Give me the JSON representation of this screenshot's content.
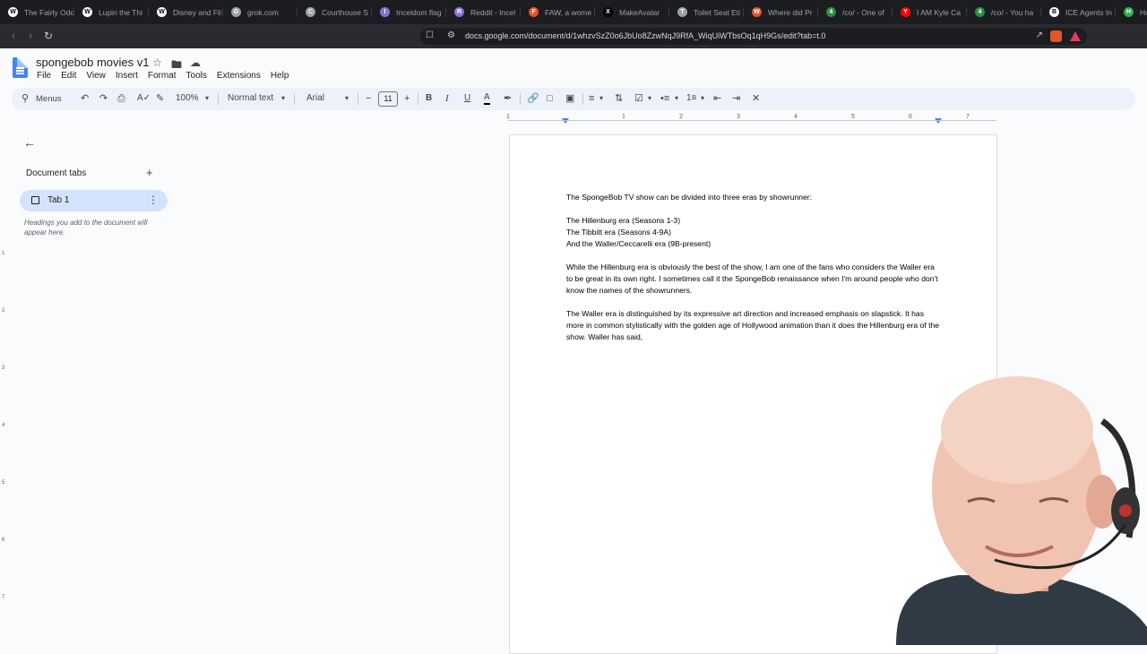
{
  "browser": {
    "tabs": [
      {
        "title": "The Fairly Odd",
        "icon": "W",
        "color": "#ffffff"
      },
      {
        "title": "Lupin the Thi",
        "icon": "W",
        "color": "#ffffff"
      },
      {
        "title": "Disney and Fli",
        "icon": "W",
        "color": "#ffffff"
      },
      {
        "title": "grok.com",
        "icon": "G",
        "color": "#9aa0a6"
      },
      {
        "title": "Courthouse S",
        "icon": "C",
        "color": "#9aa0a6"
      },
      {
        "title": "Inceldom flag",
        "icon": "I",
        "color": "#8e6fd8"
      },
      {
        "title": "Reddit - Incel",
        "icon": "R",
        "color": "#8e6fd8"
      },
      {
        "title": "FAW, a wome",
        "icon": "F",
        "color": "#e2542d"
      },
      {
        "title": "MakeAvatar",
        "icon": "X",
        "color": "#000000"
      },
      {
        "title": "Toilet Seat Eti",
        "icon": "T",
        "color": "#9aa0a6"
      },
      {
        "title": "Where did Pr",
        "icon": "W",
        "color": "#e2542d"
      },
      {
        "title": "/co/ - One of",
        "icon": "4",
        "color": "#2f8d3f"
      },
      {
        "title": "I AM Kyle Ca",
        "icon": "Y",
        "color": "#ff0000"
      },
      {
        "title": "/co/ - You ha",
        "icon": "4",
        "color": "#2f8d3f"
      },
      {
        "title": "ICE Agents In",
        "icon": "B",
        "color": "#ffffff"
      },
      {
        "title": "Hom",
        "icon": "H",
        "color": "#34a853"
      }
    ],
    "url": "docs.google.com/document/d/1whzvSzZ0o6JbUo8ZzwNqJ9RfA_WiqUiWTbsOq1qH9Gs/edit?tab=t.0"
  },
  "doc": {
    "title": "spongebob movies v1",
    "menu": [
      "File",
      "Edit",
      "View",
      "Insert",
      "Format",
      "Tools",
      "Extensions",
      "Help"
    ]
  },
  "toolbar": {
    "search_label": "Menus",
    "zoom": "100%",
    "style": "Normal text",
    "font": "Arial",
    "font_size": "11"
  },
  "ruler": {
    "h": [
      "1",
      "1",
      "2",
      "3",
      "4",
      "5",
      "6",
      "7"
    ],
    "v": [
      "1",
      "2",
      "3",
      "4",
      "5",
      "6",
      "7"
    ]
  },
  "sidebar": {
    "heading": "Document tabs",
    "tab_label": "Tab 1",
    "hint": "Headings you add to the document will appear here."
  },
  "body": {
    "p1": "The SpongeBob TV show can be divided into three eras by showrunner:",
    "l1": "The Hillenburg era (Seasons 1-3)",
    "l2": "The Tibbitt era (Seasons 4-9A)",
    "l3": "And the Waller/Ceccarelli era (9B-present)",
    "p2": "While the Hillenburg era is obviously the best of the show, I am one of the fans who considers the Waller era to be great in its own right. I sometimes call it the SpongeBob renaissance when I'm around people who don't know the names of the showrunners.",
    "p3": "The Waller era is distinguished by its expressive art direction and increased emphasis on slapstick. It has more in common stylistically with the golden age of Hollywood animation than it does the Hillenburg era of the show. Waller has said,"
  }
}
